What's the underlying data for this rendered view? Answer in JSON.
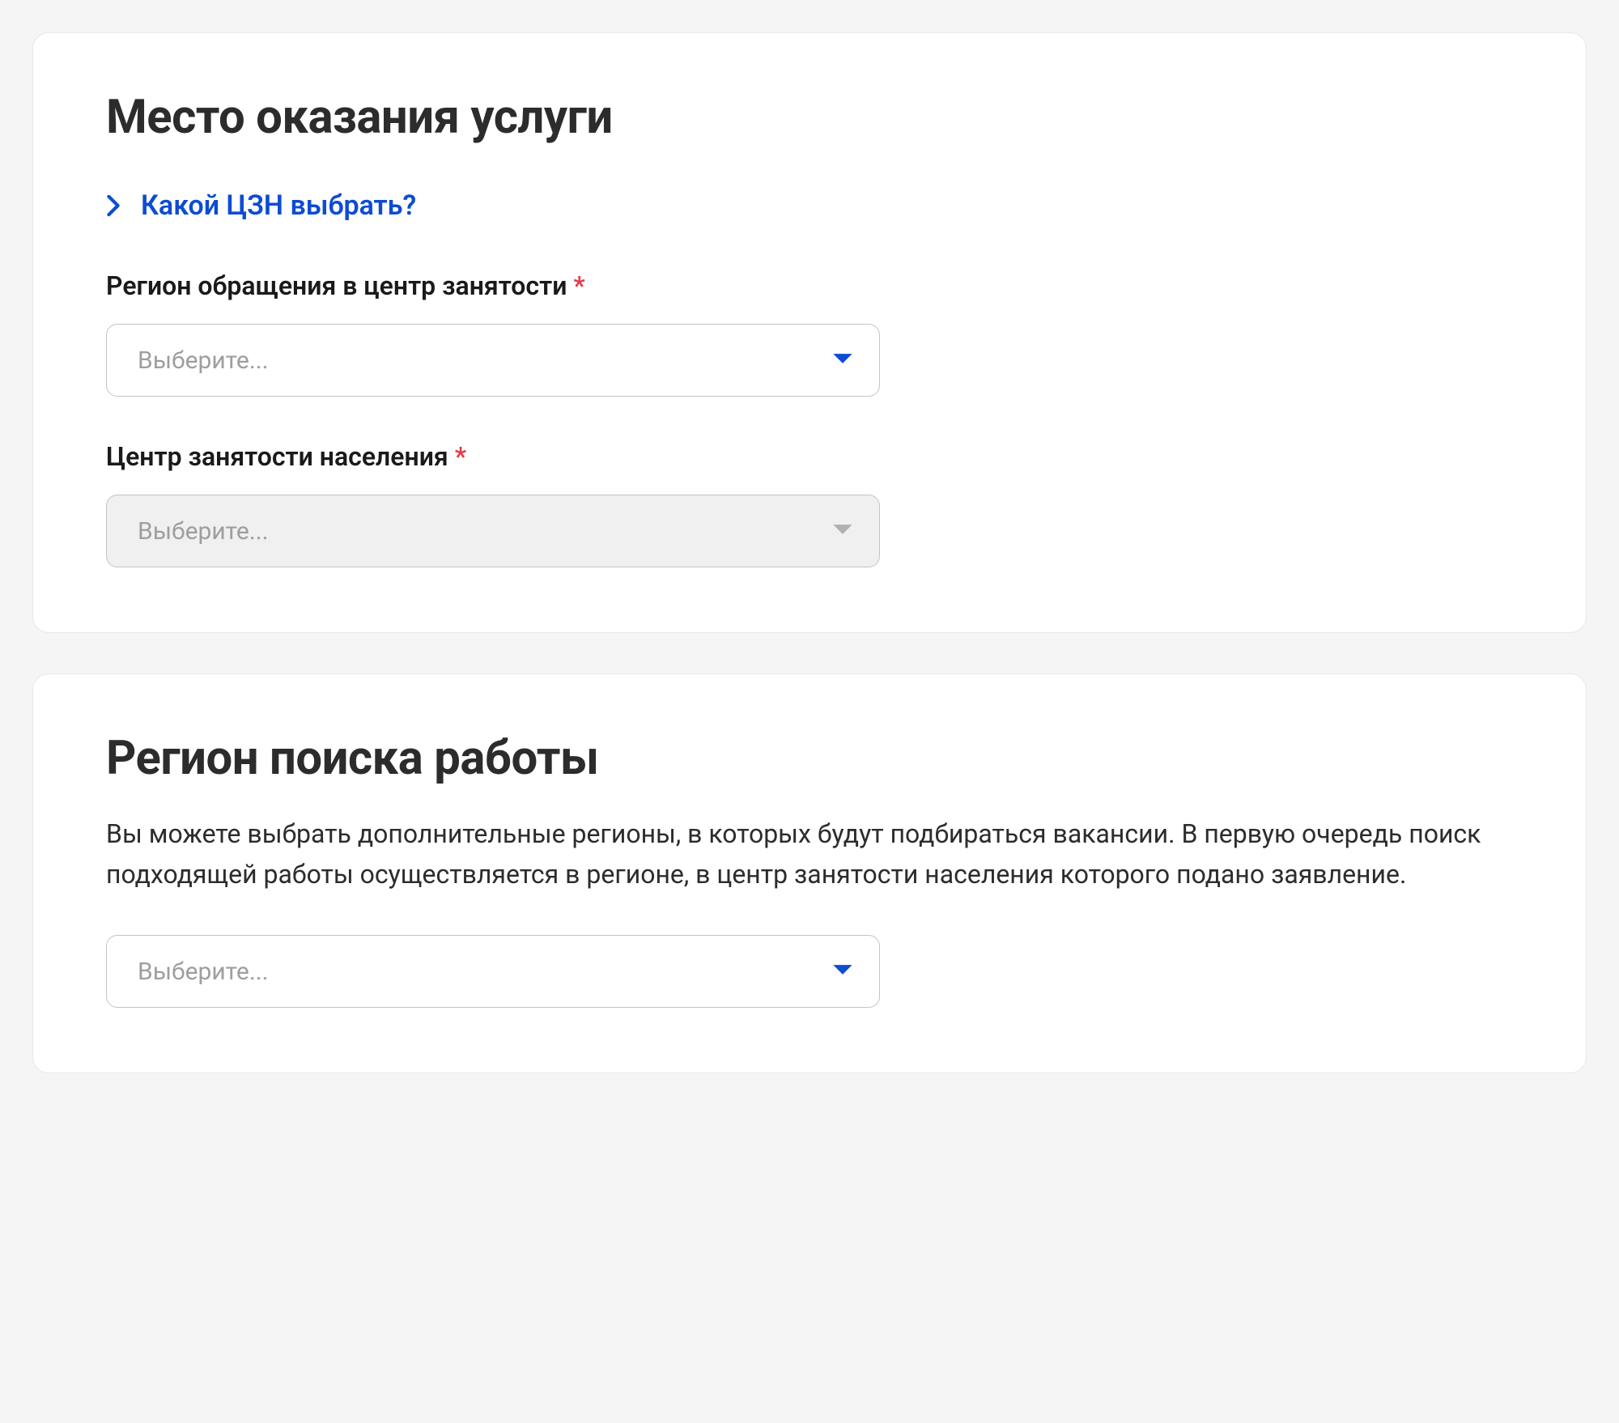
{
  "section1": {
    "title": "Место оказания услуги",
    "hint_link": "Какой ЦЗН выбрать?",
    "field_region": {
      "label": "Регион обращения в центр занятости",
      "required_mark": "*",
      "placeholder": "Выберите..."
    },
    "field_center": {
      "label": "Центр занятости населения",
      "required_mark": "*",
      "placeholder": "Выберите..."
    }
  },
  "section2": {
    "title": "Регион поиска работы",
    "description": "Вы можете выбрать дополнительные регионы, в которых будут подбираться вакансии. В первую очередь поиск подходящей работы осуществляется в регионе, в центр занятости населения которого подано заявление.",
    "field_region": {
      "placeholder": "Выберите..."
    }
  }
}
